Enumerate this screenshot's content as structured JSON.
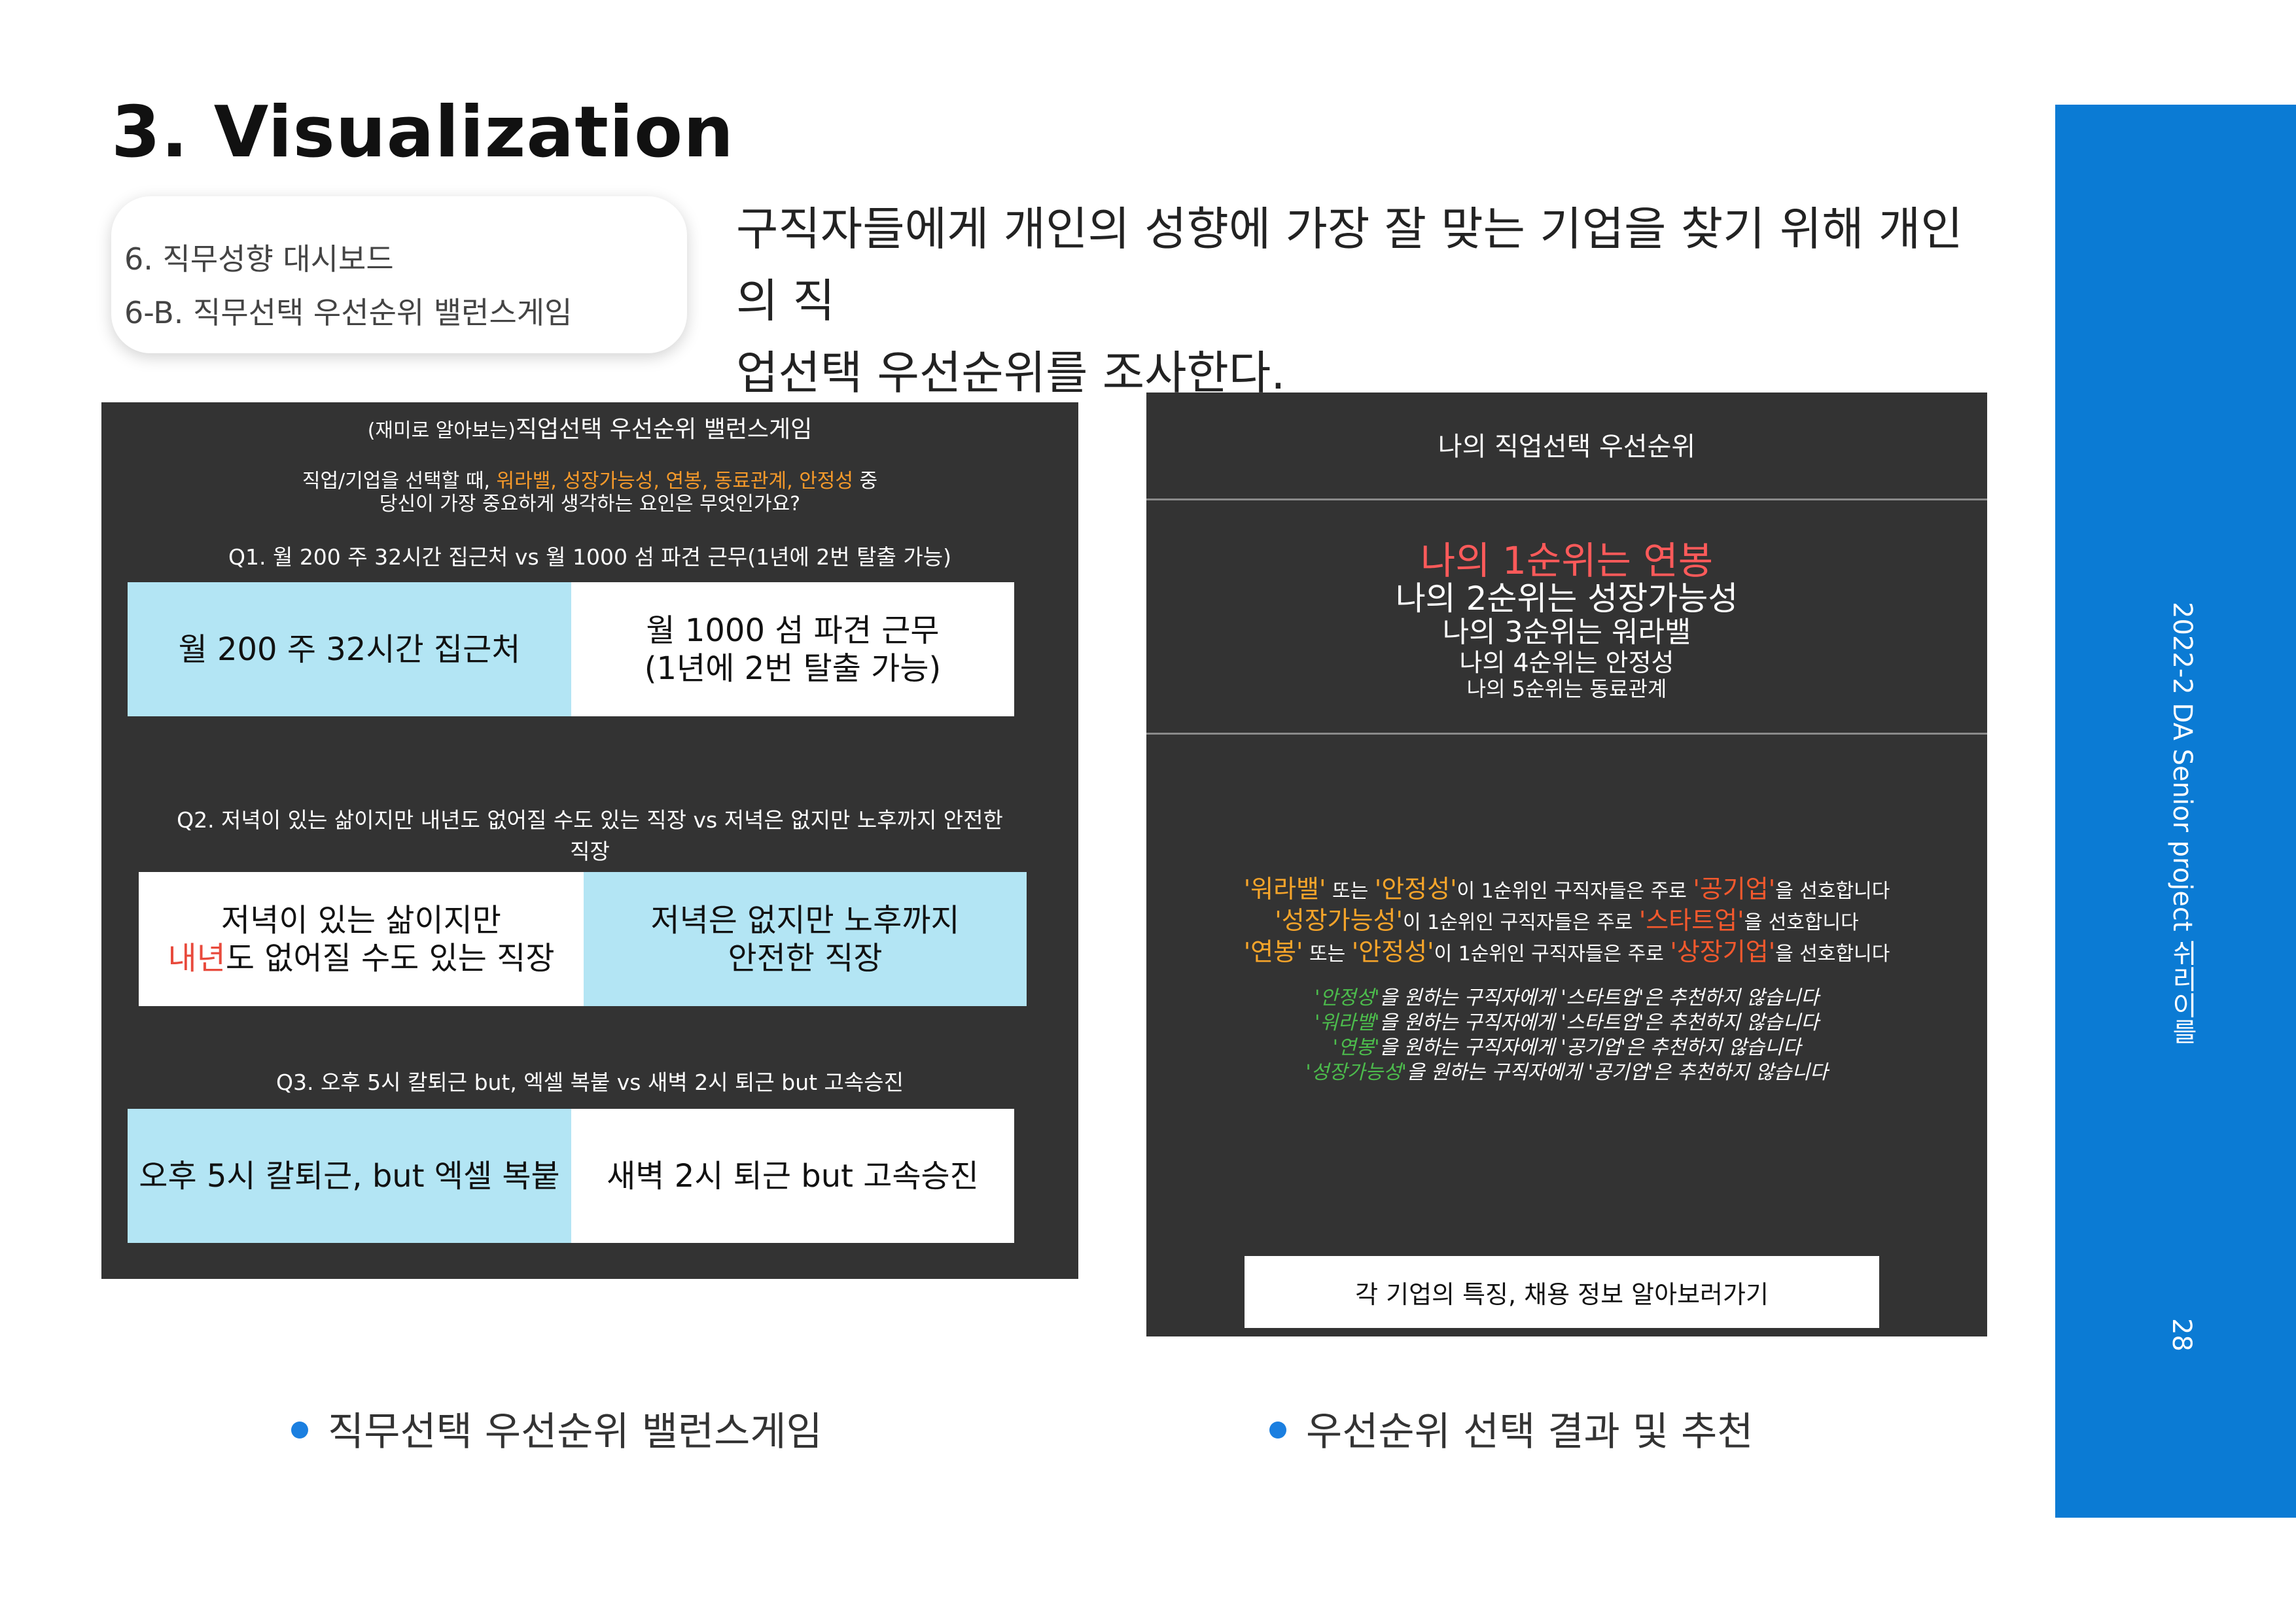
{
  "header": {
    "title": "3. Visualization",
    "toc": [
      "6. 직무성향 대시보드",
      "6-B. 직무선택 우선순위 밸런스게임"
    ],
    "intro_line1": "구직자들에게 개인의 성향에 가장 잘 맞는 기업을 찾기 위해 개인의 직",
    "intro_line2": "업선택 우선순위를 조사한다."
  },
  "game": {
    "title_prefix": "(재미로 알아보는)",
    "title_main": "직업선택 우선순위 밸런스게임",
    "intro_a": "직업/기업을 선택할 때, ",
    "intro_factors": "워라밸, 성장가능성, 연봉, 동료관계, 안정성",
    "intro_b": " 중",
    "intro_line2": "당신이 가장 중요하게 생각하는 요인은 무엇인가요?",
    "questions": [
      {
        "q": "Q1. 월 200 주 32시간 집근처 vs 월 1000 섬 파견 근무(1년에 2번 탈출 가능)",
        "left": "월 200 주 32시간 집근처",
        "right_line1": "월 1000 섬 파견 근무",
        "right_line2": "(1년에 2번 탈출 가능)"
      },
      {
        "q_line1": "Q2. 저녁이 있는 삶이지만 내년도 없어질 수도 있는 직장 vs 저녁은 없지만 노후까지 안전한",
        "q_line2": "직장",
        "left_line1": "저녁이 있는 삶이지만",
        "left_red": "내년",
        "left_line2_rest": "도 없어질 수도 있는 직장",
        "right_line1": "저녁은 없지만 노후까지",
        "right_line2": "안전한 직장"
      },
      {
        "q": "Q3. 오후 5시 칼퇴근 but, 엑셀 복붙 vs 새벽 2시 퇴근 but 고속승진",
        "left": "오후 5시 칼퇴근, but 엑셀 복붙",
        "right": "새벽 2시 퇴근 but 고속승진"
      }
    ]
  },
  "result": {
    "header": "나의 직업선택 우선순위",
    "ranks": [
      "나의 1순위는 연봉",
      "나의 2순위는 성장가능성",
      "나의 3순위는 워라밸",
      "나의 4순위는 안정성",
      "나의 5순위는 동료관계"
    ],
    "pref_lines": [
      {
        "a": "'워라밸'",
        "b": " 또는 ",
        "c": "'안정성'",
        "d": "이 1순위인 구직자들은 주로 ",
        "e": "'공기업'",
        "f": "을 선호합니다"
      },
      {
        "a": "'성장가능성'",
        "d": "이 1순위인 구직자들은 주로 ",
        "e": "'스타트업'",
        "f": "을 선호합니다"
      },
      {
        "a": "'연봉'",
        "b": " 또는 ",
        "c": "'안정성'",
        "d": "이 1순위인 구직자들은 주로 ",
        "e": "'상장기업'",
        "f": "을 선호합니다"
      }
    ],
    "not_recommended": [
      {
        "g": "'안정성'",
        "rest": "을 원하는 구직자에게 '스타트업'은 추천하지 않습니다"
      },
      {
        "g": "'워라밸'",
        "rest": "을 원하는 구직자에게 '스타트업'은 추천하지 않습니다"
      },
      {
        "g": "'연봉'",
        "rest": "을 원하는 구직자에게 '공기업'은 추천하지 않습니다"
      },
      {
        "g": "'성장가능성'",
        "rest": "을 원하는 구직자에게 '공기업'은 추천하지 않습니다"
      }
    ],
    "button": "각 기업의 특징, 채용 정보 알아보러가기"
  },
  "captions": {
    "left": "직무선택 우선순위 밸런스게임",
    "right": "우선순위 선택 결과 및 추천"
  },
  "sidebar": {
    "project": "2022-2 DA Senior project 쉬리이를",
    "page": "28"
  },
  "colors": {
    "accent_blue": "#0b7bd4",
    "panel_dark": "#333333",
    "option_selected": "#b3e5f4",
    "highlight_orange": "#f79a2a",
    "highlight_red": "#ff5a5a",
    "highlight_green": "#4cbc4c"
  }
}
